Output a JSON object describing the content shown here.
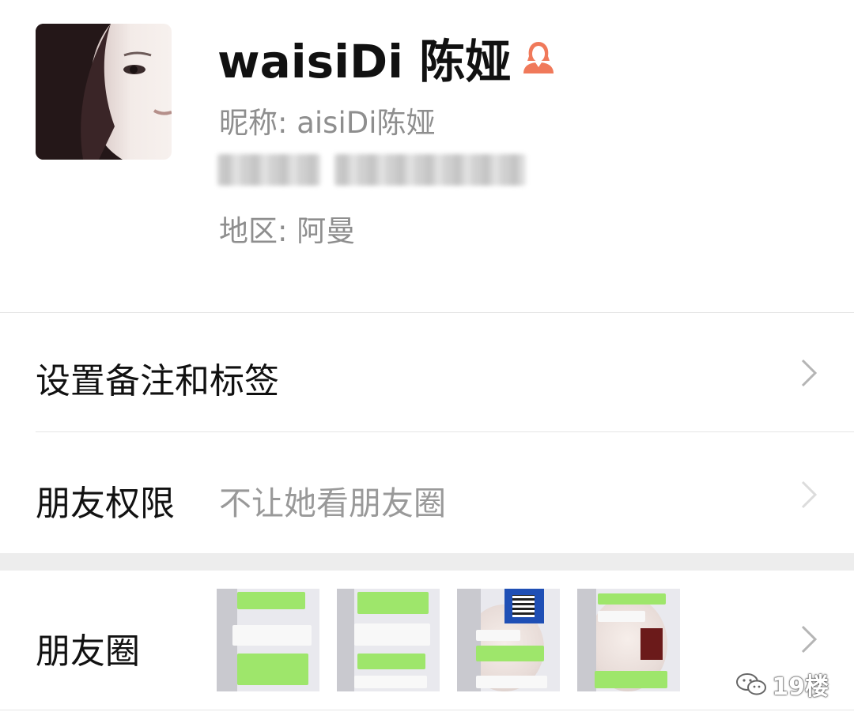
{
  "profile": {
    "display_name": "waisiDi 陈娅",
    "nickname": "昵称: aisiDi陈娅",
    "region": "地区: 阿曼",
    "gender_icon": "female-icon",
    "gender_color": "#f0795a"
  },
  "list": {
    "remark_label": "设置备注和标签",
    "permission_label": "朋友权限",
    "permission_value": "不让她看朋友圈",
    "moments_label": "朋友圈"
  },
  "watermark": {
    "text": "19楼",
    "icon": "wechat-icon"
  },
  "colors": {
    "accent_green": "#9ee66b",
    "secondary_text": "#8e8e8e"
  }
}
